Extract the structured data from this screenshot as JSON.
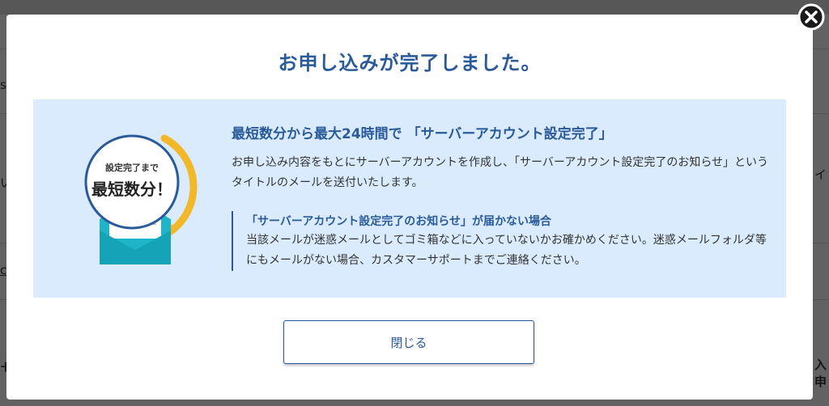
{
  "background": {
    "fragments": [
      "s",
      "イ",
      "い",
      "サ",
      "入申",
      "c"
    ]
  },
  "modal": {
    "title": "お申し込みが完了しました。",
    "illustration": {
      "line1": "設定完了まで",
      "line2": "最短数分！",
      "icon": "envelope-icon"
    },
    "headline": "最短数分から最大24時間で 「サーバーアカウント設定完了」",
    "description": "お申し込み内容をもとにサーバーアカウントを作成し、「サーバーアカウント設定完了のお知らせ」というタイトルのメールを送付いたします。",
    "notice": {
      "title": "「サーバーアカウント設定完了のお知らせ」が届かない場合",
      "text": "当該メールが迷惑メールとしてゴミ箱などに入っていないかお確かめください。迷惑メールフォルダ等にもメールがない場合、カスタマーサポートまでご連絡ください。"
    },
    "close_button_label": "閉じる",
    "close_icon": "close-icon"
  },
  "colors": {
    "accent": "#2a5a9a",
    "panel": "#d9ebfc",
    "envelope": "#1fb5c9",
    "arrow": "#f2b829"
  }
}
